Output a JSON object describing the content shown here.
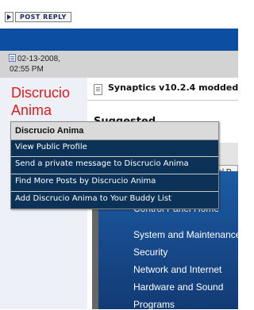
{
  "post": {
    "reply_label": "POST REPLY",
    "date": "02-13-2008,",
    "time": "02:55 PM",
    "username_line1": "Discrucio",
    "username_line2": "Anima",
    "title": "Synaptics v10.2.4 modded",
    "subtitle": "Suggested"
  },
  "user_menu": {
    "title": "Discrucio Anima",
    "items": [
      {
        "label": "View Public Profile"
      },
      {
        "label": "Send a private message to Discrucio Anima"
      },
      {
        "label": "Find More Posts by Discrucio Anima"
      },
      {
        "label": "Add Discrucio Anima to Your Buddy List"
      }
    ]
  },
  "screenshot": {
    "tab_label": "rol P",
    "control_panel_items": [
      {
        "label": "Control Panel Home"
      },
      {
        "label": "System and Maintenance"
      },
      {
        "label": "Security"
      },
      {
        "label": "Network and Internet"
      },
      {
        "label": "Hardware and Sound"
      },
      {
        "label": "Programs"
      }
    ]
  },
  "colors": {
    "forum_blue": "#0b4ea2",
    "username_red": "#e01a1a",
    "menu_bg": "#0c3357",
    "date_bar": "#d3d3d3"
  }
}
